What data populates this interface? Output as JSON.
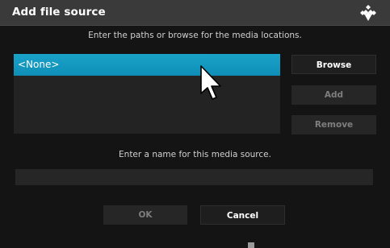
{
  "dialog": {
    "title": "Add file source",
    "paths_instruction": "Enter the paths or browse for the media locations.",
    "paths": [
      {
        "label": "<None>",
        "selected": true
      }
    ],
    "buttons": {
      "browse": "Browse",
      "add": "Add",
      "remove": "Remove"
    },
    "name_instruction": "Enter a name for this media source.",
    "name_field": {
      "value": "",
      "placeholder": ""
    },
    "footer": {
      "ok": "OK",
      "cancel": "Cancel"
    }
  },
  "icons": {
    "logo": "kodi-logo-icon",
    "cursor": "mouse-pointer-icon"
  },
  "colors": {
    "titlebar": "#3a3a3a",
    "background": "#141414",
    "selection": "#12a0c8",
    "button_active_text": "#ffffff",
    "button_disabled_text": "#7e7e7e"
  }
}
